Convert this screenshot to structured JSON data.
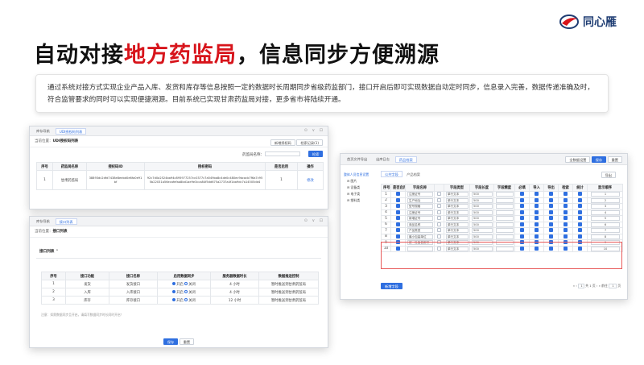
{
  "brand": {
    "name": "同心雁",
    "accent": "#1f3d73"
  },
  "title": {
    "prefix": "自动对接",
    "highlight": "地方药监局",
    "suffix": "，信息同步方便溯源",
    "highlight_color": "#d7141b"
  },
  "description": "通过系统对接方式实现企业产品入库、发货和库存等信息按照一定的数据时长周期同步省级药监部门，接口开启后即可实现数据自动定时同步，信息录入完善，数据传递准确及时，符合监管要求的同时可以实现便捷溯源。目前系统已实现甘肃药监局对接，更多省市将陆续开通。",
  "win1": {
    "tabs": [
      "库存导航",
      "UDI授权码列表"
    ],
    "crumb_label": "当前位置：",
    "crumb_page": "UDI授权码列表",
    "buttons": [
      "新增授权码",
      "检索记录(1)"
    ],
    "search_label": "药监局名称：",
    "search_button": "检索",
    "columns": [
      "序号",
      "药监局名称",
      "授权码ID",
      "授权密码",
      "是否启用",
      "操作"
    ],
    "rows": [
      {
        "no": "1",
        "name": "甘肃药监局",
        "id": "38893dc2dfd7438e8eebd0e6fa0e91bf",
        "secret": "92c7d0a2524ba94c895977257cc0377c7a549ba8c4de0c480ec9bcacb7f6a7c955b22031a56ecafefaa8bd1ae9e3cca84f5dd675a2737a4f1ba9dc7a14505dd4",
        "enabled": "1",
        "op": "修改"
      }
    ]
  },
  "win2": {
    "tabs": [
      "库存导航",
      "接口列表"
    ],
    "crumb_label": "当前位置：",
    "crumb_page": "接口列表",
    "section": "接口列表",
    "columns": [
      "序号",
      "接口功能",
      "接口名称",
      "启用数据同步",
      "服务器数据时长",
      "数据推送控制"
    ],
    "rows": [
      {
        "no": "1",
        "func": "发货",
        "name": "发货接口",
        "on": "开启",
        "off": "关闭",
        "dur": "4",
        "unit": "小时",
        "push": "暂时推送到甘肃药监局"
      },
      {
        "no": "2",
        "func": "入库",
        "name": "入库接口",
        "on": "开启",
        "off": "关闭",
        "dur": "4",
        "unit": "小时",
        "push": "暂时推送到甘肃药监局"
      },
      {
        "no": "3",
        "func": "库存",
        "name": "库存接口",
        "on": "开启",
        "off": "关闭",
        "dur": "12",
        "unit": "小时",
        "push": "暂时推送到甘肃药监局"
      }
    ],
    "note": "注意：如需数据同步且开启，请填写数据同步时长同时开启！",
    "save": "保存",
    "reset": "重置"
  },
  "win3": {
    "tabs": [
      "首页文件导出",
      "出库日志",
      "药品档案"
    ],
    "top_buttons": [
      "全数据设置",
      "保存",
      "重置"
    ],
    "tree": [
      "整体人员信息设置",
      "图片",
      "设备类",
      "电子类",
      "塑料类"
    ],
    "subtabs": [
      "公共字段",
      "产品档案"
    ],
    "export": "导出",
    "columns": [
      "序号",
      "是否启用",
      "字段名称",
      "",
      "字段类型",
      "字段长度",
      "字段精度",
      "必填",
      "导入",
      "导出",
      "检索",
      "统计",
      "显示顺序"
    ],
    "rows": [
      {
        "no": "1",
        "name": "注册证号",
        "type": "单行文本",
        "len": "500",
        "order": "1"
      },
      {
        "no": "2",
        "name": "生产地址",
        "type": "单行文本",
        "len": "500",
        "order": "2"
      },
      {
        "no": "3",
        "name": "型号规格",
        "type": "单行文本",
        "len": "500",
        "order": "3"
      },
      {
        "no": "4",
        "name": "注册证号",
        "type": "单行文本",
        "len": "500",
        "order": "4"
      },
      {
        "no": "5",
        "name": "新增证号",
        "type": "单行文本",
        "len": "500",
        "order": "5"
      },
      {
        "no": "6",
        "name": "商品名称",
        "type": "单行文本",
        "len": "500",
        "order": "6"
      },
      {
        "no": "7",
        "name": "产品类型",
        "type": "单行文本",
        "len": "500",
        "order": "7"
      },
      {
        "no": "8",
        "name": "最小包装单位",
        "type": "单行文本",
        "len": "500",
        "order": "8"
      },
      {
        "no": "9",
        "name": "统一社会信用号",
        "type": "单行文本",
        "len": "500",
        "order": "9"
      },
      {
        "no": "10",
        "name": "",
        "type": "单行文本",
        "len": "500",
        "order": "10"
      }
    ],
    "add_button": "新增字段",
    "pager": {
      "page": "1",
      "of": "共 1 页",
      "goto": "前往",
      "goto_page": "1",
      "unit": "页"
    }
  }
}
